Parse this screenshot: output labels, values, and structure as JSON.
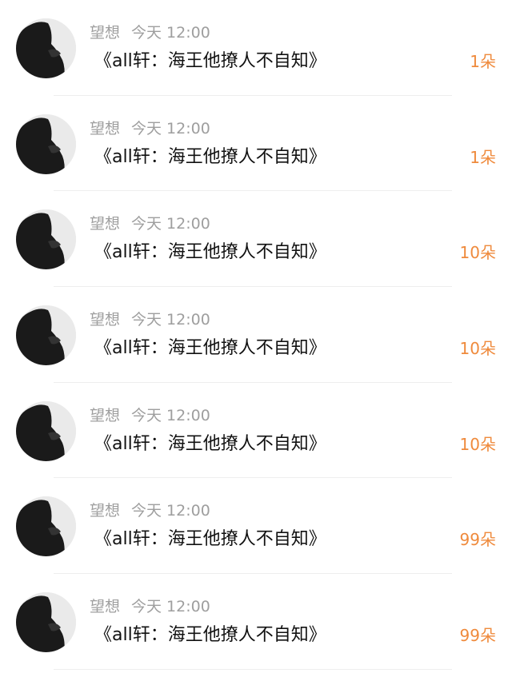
{
  "colors": {
    "background": "#ffffff",
    "meta_text": "#9e9e9e",
    "message_text": "#111111",
    "count_text": "#ef8a3c",
    "divider": "#eeeeee"
  },
  "messages": [
    {
      "sender": "望想",
      "time": "今天 12:00",
      "text": "《all轩：海王他撩人不自知》",
      "count": "1朵",
      "avatar_icon": "dark-silhouette-avatar"
    },
    {
      "sender": "望想",
      "time": "今天 12:00",
      "text": "《all轩：海王他撩人不自知》",
      "count": "1朵",
      "avatar_icon": "dark-silhouette-avatar"
    },
    {
      "sender": "望想",
      "time": "今天 12:00",
      "text": "《all轩：海王他撩人不自知》",
      "count": "10朵",
      "avatar_icon": "dark-silhouette-avatar"
    },
    {
      "sender": "望想",
      "time": "今天 12:00",
      "text": "《all轩：海王他撩人不自知》",
      "count": "10朵",
      "avatar_icon": "dark-silhouette-avatar"
    },
    {
      "sender": "望想",
      "time": "今天 12:00",
      "text": "《all轩：海王他撩人不自知》",
      "count": "10朵",
      "avatar_icon": "dark-silhouette-avatar"
    },
    {
      "sender": "望想",
      "time": "今天 12:00",
      "text": "《all轩：海王他撩人不自知》",
      "count": "99朵",
      "avatar_icon": "dark-silhouette-avatar"
    },
    {
      "sender": "望想",
      "time": "今天 12:00",
      "text": "《all轩：海王他撩人不自知》",
      "count": "99朵",
      "avatar_icon": "dark-silhouette-avatar"
    }
  ]
}
